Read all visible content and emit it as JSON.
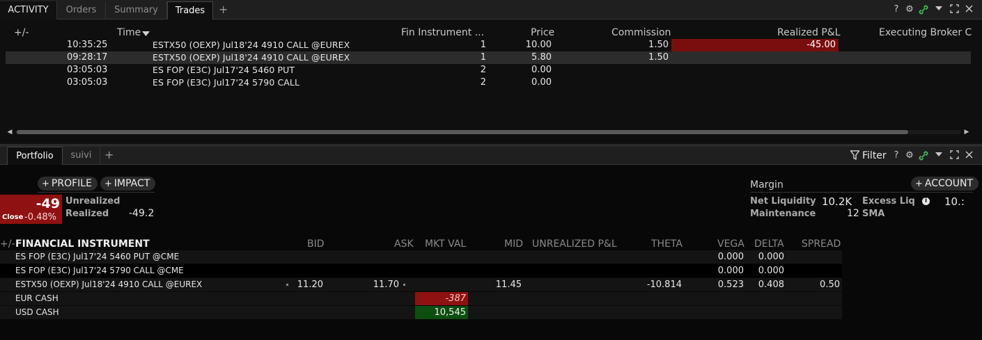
{
  "top": {
    "tabs": [
      {
        "label": "ACTIVITY"
      },
      {
        "label": "Orders"
      },
      {
        "label": "Summary"
      },
      {
        "label": "Trades"
      }
    ],
    "add_tab": "+",
    "help": "?",
    "columns": {
      "expand": "+/-",
      "time": "Time",
      "fin_instrument": "Fin Instrument ...",
      "price": "Price",
      "commission": "Commission",
      "realized_pnl": "Realized P&L",
      "executing_broker": "Executing Broker C"
    },
    "rows": [
      {
        "time": "10:35:25",
        "instrument": "ESTX50 (OEXP) Jul18'24 4910 CALL @EUREX",
        "qty": "1",
        "price": "10.00",
        "commission": "1.50",
        "realized": "-45.00"
      },
      {
        "time": "09:28:17",
        "instrument": "ESTX50 (OEXP) Jul18'24 4910 CALL @EUREX",
        "qty": "1",
        "price": "5.80",
        "commission": "1.50",
        "realized": ""
      },
      {
        "time": "03:05:03",
        "instrument": "ES FOP (E3C) Jul17'24 5460 PUT",
        "qty": "2",
        "price": "0.00",
        "commission": "",
        "realized": ""
      },
      {
        "time": "03:05:03",
        "instrument": "ES FOP (E3C) Jul17'24 5790 CALL",
        "qty": "2",
        "price": "0.00",
        "commission": "",
        "realized": ""
      }
    ]
  },
  "bottom": {
    "tabs": [
      {
        "label": "Portfolio"
      },
      {
        "label": "suivi"
      }
    ],
    "add_tab": "+",
    "filter_label": "Filter",
    "help": "?",
    "profile_button": "PROFILE",
    "impact_button": "IMPACT",
    "account_button": "ACCOUNT",
    "pnl": {
      "value": "-49",
      "close_label": "Close",
      "close_pct": "-0.48%",
      "unrealized_label": "Unrealized",
      "realized_label": "Realized",
      "realized_value": "-49.2"
    },
    "margin": {
      "title": "Margin",
      "net_liq_label": "Net Liquidity",
      "net_liq_value": "10.2K",
      "excess_label": "Excess Liq",
      "excess_value": "10.:",
      "maintenance_label": "Maintenance",
      "maintenance_value": "12",
      "sma_label": "SMA"
    },
    "columns": {
      "expand": "+/-",
      "instrument": "FINANCIAL INSTRUMENT",
      "bid": "BID",
      "ask": "ASK",
      "mkt_val": "MKT VAL",
      "mid": "MID",
      "unrealized": "UNREALIZED P&L",
      "theta": "THETA",
      "vega": "VEGA",
      "delta": "DELTA",
      "spread": "SPREAD"
    },
    "rows": [
      {
        "instrument": "ES FOP (E3C) Jul17'24 5460 PUT @CME",
        "bid": "",
        "ask": "",
        "mkt_val": "",
        "mid": "",
        "theta": "",
        "vega": "0.000",
        "delta": "0.000",
        "spread": ""
      },
      {
        "instrument": "ES FOP (E3C) Jul17'24 5790 CALL @CME",
        "bid": "",
        "ask": "",
        "mkt_val": "",
        "mid": "",
        "theta": "",
        "vega": "0.000",
        "delta": "0.000",
        "spread": ""
      },
      {
        "instrument": "ESTX50 (OEXP) Jul18'24 4910 CALL @EUREX",
        "bid": "11.20",
        "ask": "11.70",
        "mkt_val": "",
        "mid": "11.45",
        "theta": "-10.814",
        "vega": "0.523",
        "delta": "0.408",
        "spread": "0.50"
      },
      {
        "instrument": "EUR CASH",
        "bid": "",
        "ask": "",
        "mkt_val": "-387",
        "mid": "",
        "theta": "",
        "vega": "",
        "delta": "",
        "spread": ""
      },
      {
        "instrument": "USD CASH",
        "bid": "",
        "ask": "",
        "mkt_val": "10,545",
        "mid": "",
        "theta": "",
        "vega": "",
        "delta": "",
        "spread": ""
      }
    ]
  },
  "colors": {
    "negative_bg": "#8f1111",
    "positive_bg": "#0e4d10",
    "link_icon": "#3fbf5a"
  },
  "icons": [
    "plus-icon",
    "help-icon",
    "gear-icon",
    "link-icon",
    "chevron-down-icon",
    "maximize-icon",
    "close-icon",
    "sort-down-icon",
    "filter-icon",
    "info-icon",
    "scroll-left-icon",
    "scroll-right-icon"
  ]
}
